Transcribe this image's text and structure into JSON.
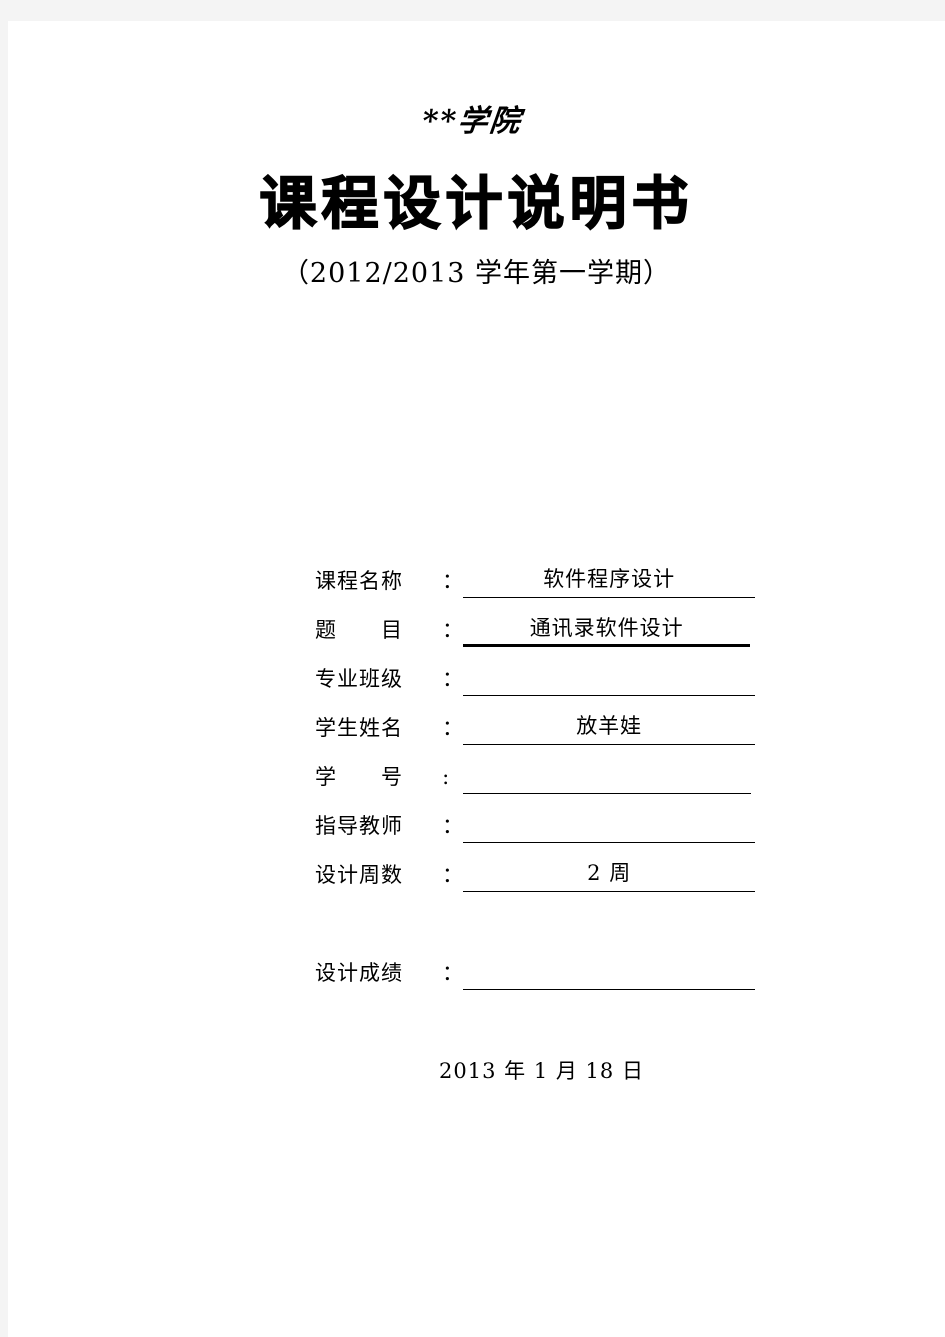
{
  "document": {
    "school_name": "**学院",
    "title": "课程设计说明书",
    "subtitle": "（2012/2013 学年第一学期）",
    "date": "2013 年 1 月 18 日"
  },
  "form": {
    "rows": [
      {
        "label": "课程名称",
        "colon": "：",
        "value": "软件程序设计"
      },
      {
        "label": "题　　目",
        "colon": "：",
        "value": "通讯录软件设计"
      },
      {
        "label": "专业班级",
        "colon": "：",
        "value": ""
      },
      {
        "label": "学生姓名",
        "colon": "：",
        "value": "放羊娃"
      },
      {
        "label": "学　　号",
        "colon": ":",
        "value": ""
      },
      {
        "label": "指导教师",
        "colon": "：",
        "value": ""
      },
      {
        "label": "设计周数",
        "colon": "：",
        "value": "2 周"
      }
    ],
    "grade_row": {
      "label": "设计成绩",
      "colon": "：",
      "value": ""
    }
  },
  "colors": {
    "page_background": "#ffffff",
    "canvas_background": "#f4f4f4",
    "text": "#000000",
    "rule": "#000000"
  }
}
